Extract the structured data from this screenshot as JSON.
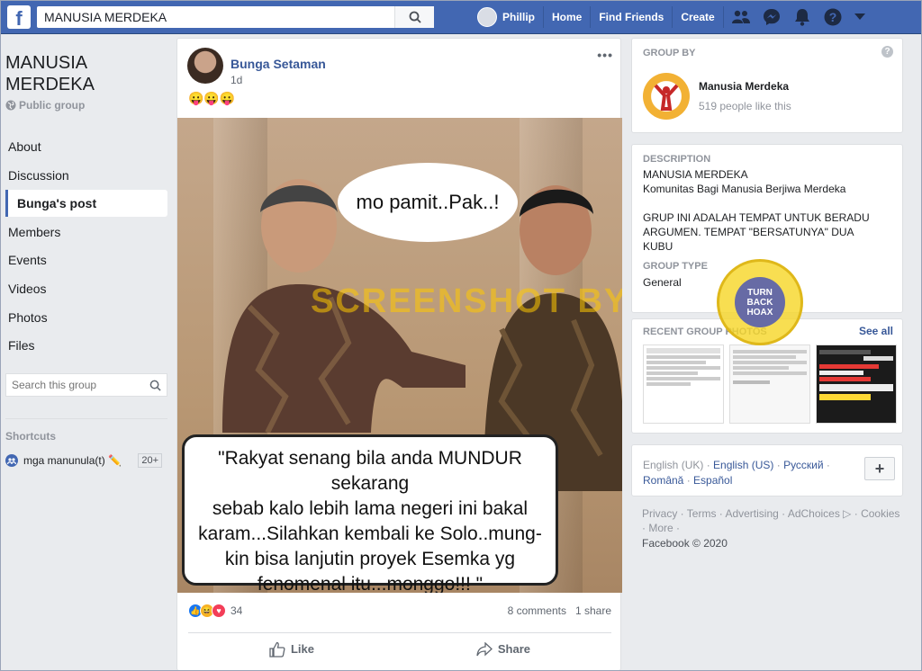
{
  "topbar": {
    "logo": "f",
    "search_value": "MANUSIA MERDEKA",
    "user_name": "Phillip",
    "home": "Home",
    "find_friends": "Find Friends",
    "create": "Create"
  },
  "left": {
    "group_name": "MANUSIA MERDEKA",
    "group_type": "Public group",
    "menu": [
      "About",
      "Discussion",
      "Bunga's post",
      "Members",
      "Events",
      "Videos",
      "Photos",
      "Files"
    ],
    "search_placeholder": "Search this group",
    "shortcuts_title": "Shortcuts",
    "shortcut_name": "mga manunula(t) ✏️",
    "shortcut_badge": "20+"
  },
  "post": {
    "author": "Bunga Setaman",
    "time": "1d",
    "text": "😛😛😛",
    "more": "•••",
    "bubble": "mo pamit..Pak..!",
    "quote_lines": [
      "\"Rakyat senang bila anda MUNDUR",
      "sekarang",
      "sebab kalo lebih lama negeri ini bakal",
      "karam...Silahkan kembali ke Solo..mung-",
      "kin bisa lanjutin proyek Esemka yg",
      "fenomenal itu...monggo!!! \""
    ],
    "watermark": "SCREENSHOT BY",
    "reaction_count": "34",
    "comments": "8 comments",
    "shares": "1 share",
    "like": "Like",
    "share": "Share"
  },
  "right": {
    "group_by_title": "GROUP BY",
    "group_by_name": "Manusia Merdeka",
    "group_by_likes": "519 people like this",
    "description_title": "DESCRIPTION",
    "description_lines": [
      "MANUSIA MERDEKA",
      "Komunitas Bagi Manusia Berjiwa Merdeka",
      "",
      "GRUP INI ADALAH TEMPAT UNTUK BERADU",
      "ARGUMEN. TEMPAT \"BERSATUNYA\" DUA",
      "KUBU"
    ],
    "group_type_title": "GROUP TYPE",
    "group_type_value": "General",
    "recent_photos_title": "RECENT GROUP PHOTOS",
    "see_all": "See all",
    "stamp_text": "TURN BACK HOAX",
    "languages": [
      "English (UK)",
      "English (US)",
      "Русский",
      "Română",
      "Español"
    ],
    "footer": "Privacy · Terms · Advertising · AdChoices ▷ · Cookies · More ·",
    "copyright": "Facebook © 2020"
  }
}
